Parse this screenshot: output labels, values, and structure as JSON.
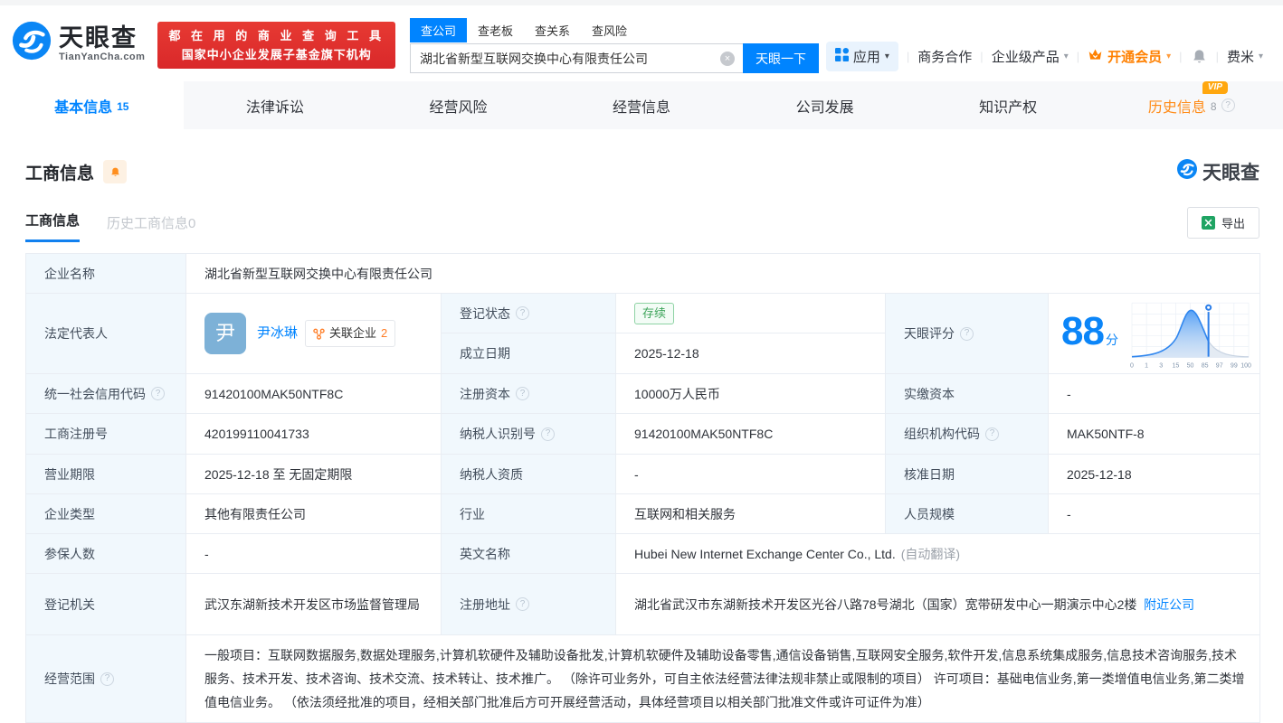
{
  "icons": {
    "help": "?",
    "clear": "×",
    "caret": "▾",
    "sep": "|"
  },
  "header": {
    "logo": {
      "title": "天眼查",
      "subtitle": "TianYanCha.com"
    },
    "banner": {
      "line1": "都 在 用 的 商 业 查 询 工 具",
      "line2": "国家中小企业发展子基金旗下机构"
    },
    "search": {
      "tabs": [
        {
          "label": "查公司"
        },
        {
          "label": "查老板"
        },
        {
          "label": "查关系"
        },
        {
          "label": "查风险"
        }
      ],
      "value": "湖北省新型互联网交换中心有限责任公司",
      "button": "天眼一下"
    },
    "nav": {
      "apps": "应用",
      "cooperation": "商务合作",
      "enterprise": "企业级产品",
      "vip": "开通会员",
      "user": "费米"
    }
  },
  "tabs": [
    {
      "label": "基本信息",
      "count": "15"
    },
    {
      "label": "法律诉讼"
    },
    {
      "label": "经营风险"
    },
    {
      "label": "经营信息"
    },
    {
      "label": "公司发展"
    },
    {
      "label": "知识产权"
    },
    {
      "label": "历史信息",
      "count": "8",
      "badge": "VIP"
    }
  ],
  "section": {
    "title": "工商信息",
    "subtab_active": "工商信息",
    "subtab_history": "历史工商信息0",
    "export_label": "导出",
    "watermark": "天眼查"
  },
  "score": {
    "label": "天眼评分",
    "value": "88",
    "unit": "分",
    "ticks": [
      "0",
      "1",
      "3",
      "15",
      "50",
      "85",
      "97",
      "99",
      "100"
    ]
  },
  "chart_data": {
    "type": "area",
    "title": "天眼评分分布曲线",
    "x_ticks": [
      0,
      1,
      3,
      15,
      50,
      85,
      97,
      99,
      100
    ],
    "marker_value": 88,
    "description": "钟形分布曲线, 峰值位于50附近, 标记点位于88分处, 标记左侧为蓝色填充, 右侧为灰色"
  },
  "company": {
    "name_label": "企业名称",
    "name": "湖北省新型互联网交换中心有限责任公司",
    "legal_label": "法定代表人",
    "avatar": "尹",
    "legal_name": "尹冰琳",
    "related_label": "关联企业",
    "related_count": "2",
    "fields": {
      "reg_status": {
        "label": "登记状态",
        "value": "存续"
      },
      "establish_date": {
        "label": "成立日期",
        "value": "2025-12-18"
      },
      "credit_code": {
        "label": "统一社会信用代码",
        "value": "91420100MAK50NTF8C"
      },
      "reg_capital": {
        "label": "注册资本",
        "value": "10000万人民币"
      },
      "paid_capital": {
        "label": "实缴资本",
        "value": "-"
      },
      "reg_no": {
        "label": "工商注册号",
        "value": "420199110041733"
      },
      "taxpayer_no": {
        "label": "纳税人识别号",
        "value": "91420100MAK50NTF8C"
      },
      "org_code": {
        "label": "组织机构代码",
        "value": "MAK50NTF-8"
      },
      "term": {
        "label": "营业期限",
        "value": "2025-12-18 至 无固定期限"
      },
      "taxpayer_quality": {
        "label": "纳税人资质",
        "value": "-"
      },
      "approve_date": {
        "label": "核准日期",
        "value": "2025-12-18"
      },
      "type": {
        "label": "企业类型",
        "value": "其他有限责任公司"
      },
      "industry": {
        "label": "行业",
        "value": "互联网和相关服务"
      },
      "staff": {
        "label": "人员规模",
        "value": "-"
      },
      "insured": {
        "label": "参保人数",
        "value": "-"
      },
      "en_name": {
        "label": "英文名称",
        "value": "Hubei New Internet Exchange Center Co., Ltd.",
        "note": "(自动翻译)"
      },
      "authority": {
        "label": "登记机关",
        "value": "武汉东湖新技术开发区市场监督管理局"
      },
      "address": {
        "label": "注册地址",
        "value": "湖北省武汉市东湖新技术开发区光谷八路78号湖北（国家）宽带研发中心一期演示中心2楼",
        "link": "附近公司"
      },
      "scope": {
        "label": "经营范围",
        "value": "一般项目：互联网数据服务,数据处理服务,计算机软硬件及辅助设备批发,计算机软硬件及辅助设备零售,通信设备销售,互联网安全服务,软件开发,信息系统集成服务,信息技术咨询服务,技术服务、技术开发、技术咨询、技术交流、技术转让、技术推广。 （除许可业务外，可自主依法经营法律法规非禁止或限制的项目） 许可项目：基础电信业务,第一类增值电信业务,第二类增值电信业务。 （依法须经批准的项目，经相关部门批准后方可开展经营活动，具体经营项目以相关部门批准文件或许可证件为准）"
      }
    }
  }
}
